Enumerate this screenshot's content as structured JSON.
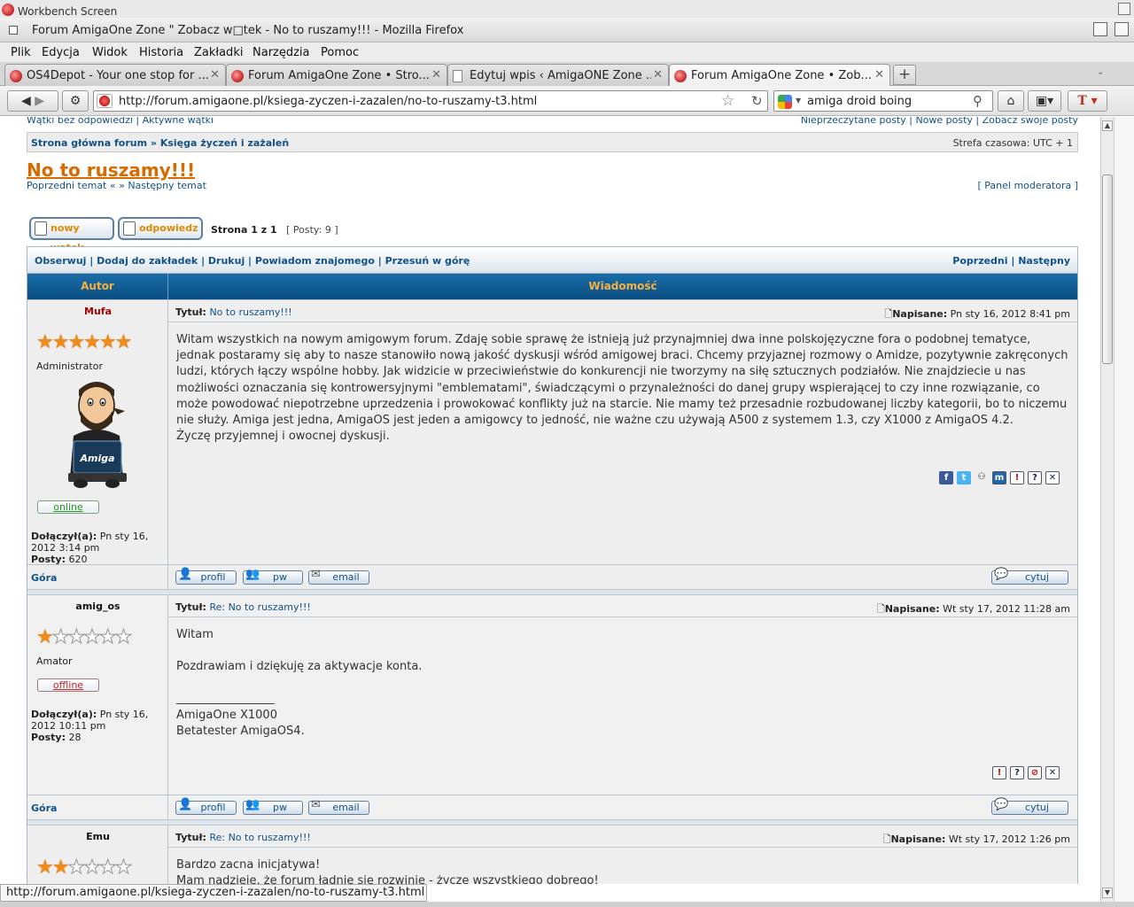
{
  "screen": {
    "title": "Workbench Screen"
  },
  "window": {
    "title": "Forum AmigaOne Zone \" Zobacz w□tek - No to ruszamy!!! - Mozilla Firefox"
  },
  "menu": [
    "Plik",
    "Edycja",
    "Widok",
    "Historia",
    "Zakładki",
    "Narzędzia",
    "Pomoc"
  ],
  "tabs": [
    {
      "label": "OS4Depot - Your one stop for ...",
      "icon": "amiga-ball-icon"
    },
    {
      "label": "Forum AmigaOne Zone • Stro...",
      "icon": "amiga-ball-icon"
    },
    {
      "label": "Edytuj wpis ‹ AmigaONE Zone ...",
      "icon": "page-icon"
    },
    {
      "label": "Forum AmigaOne Zone • Zob...",
      "icon": "amiga-ball-icon",
      "active": true
    }
  ],
  "nav": {
    "url": "http://forum.amigaone.pl/ksiega-zyczen-i-zazalen/no-to-ruszamy-t3.html",
    "search_query": "amiga droid boing"
  },
  "page": {
    "top_links_left": "Wątki bez odpowiedzi | Aktywne wątki",
    "top_links_right": "Nieprzeczytane posty | Nowe posty | Zobacz swoje posty",
    "breadcrumb": "Strona główna forum » Księga życzeń i zażaleń",
    "timezone": "Strefa czasowa: UTC + 1",
    "title": "No to ruszamy!!!",
    "prev_next": "Poprzedni temat « » Następny temat",
    "moderator_panel": "[ Panel moderatora ]",
    "new_topic": "nowy wątek",
    "reply": "odpowiedz",
    "page_of": "Strona 1 z 1",
    "post_count": "[ Posty: 9 ]",
    "toolbar_left": "Obserwuj | Dodaj do zakładek | Drukuj | Powiadom znajomego | Przesuń w górę",
    "toolbar_right": "Poprzedni | Następny",
    "col_author": "Autor",
    "col_message": "Wiadomość",
    "top_link": "Góra",
    "btn_profile": "profil",
    "btn_pm": "pw",
    "btn_email": "email",
    "btn_quote": "cytuj",
    "subject_label": "Tytuł:",
    "posted_label": "Napisane:"
  },
  "posts": [
    {
      "author": "Mufa",
      "author_color": "#aa0000",
      "stars": 6,
      "rank": "Administrator",
      "status": "online",
      "status_color": "#229922",
      "joined_label": "Dołączył(a):",
      "joined": "Pn sty 16, 2012 3:14 pm",
      "posts_label": "Posty:",
      "posts": "620",
      "subject": "No to ruszamy!!!",
      "date": "Pn sty 16, 2012 8:41 pm",
      "body": "Witam wszystkich na nowym amigowym forum. Zdaję sobie sprawę że istnieją już przynajmniej dwa inne polskojęzyczne fora o podobnej tematyce, jednak postaramy się aby to nasze stanowiło nową jakość dyskusji wśród amigowej braci. Chcemy przyjaznej rozmowy o Amidze, pozytywnie zakręconych ludzi, których łączy wspólne hobby. Jak widzicie w przeciwieństwie do konkurencji nie tworzymy na siłę sztucznych podziałów. Nie znajdziecie u nas możliwości oznaczania się kontrowersyjnymi \"emblematami\", świadczącymi o przynależności do danej grupy wspierającej to czy inne rozwiązanie, co może powodować niepotrzebne uprzedzenia i prowokować konflikty już na starcie. Nie mamy też przesadnie rozbudowanej liczby kategorii, bo to niczemu nie służy. Amiga jest jedna, AmigaOS jest jeden a amigowcy to jedność, nie ważne czu używają A500 z systemem 1.3, czy X1000 z AmigaOS 4.2.",
      "body2": "Życzę przyjemnej i owocnej dyskusji."
    },
    {
      "author": "amig_os",
      "author_color": "#111111",
      "stars": 1,
      "rank": "Amator",
      "status": "offline",
      "status_color": "#cc2222",
      "joined_label": "Dołączył(a):",
      "joined": "Pn sty 16, 2012 10:11 pm",
      "posts_label": "Posty:",
      "posts": "28",
      "subject": "Re: No to ruszamy!!!",
      "date": "Wt sty 17, 2012 11:28 am",
      "line1": "Witam",
      "line2": "Pozdrawiam i dziękuję za aktywacje konta.",
      "sig_rule": "_________________",
      "sig1": "AmigaOne X1000",
      "sig2": "Betatester AmigaOS4."
    },
    {
      "author": "Emu",
      "author_color": "#111111",
      "stars": 2,
      "subject": "Re: No to ruszamy!!!",
      "date": "Wt sty 17, 2012 1:26 pm",
      "line1": "Bardzo zacna inicjatywa!",
      "line2": "Mam nadzieje, że forum ładnie się rozwinie - życzę wszystkiego dobrego!"
    }
  ],
  "statusbar": "http://forum.amigaone.pl/ksiega-zyczen-i-zazalen/no-to-ruszamy-t3.html",
  "colors": {
    "accent": "#105289",
    "title": "#d86a00",
    "header": "#0a4d82",
    "header_text": "#f4b040"
  }
}
